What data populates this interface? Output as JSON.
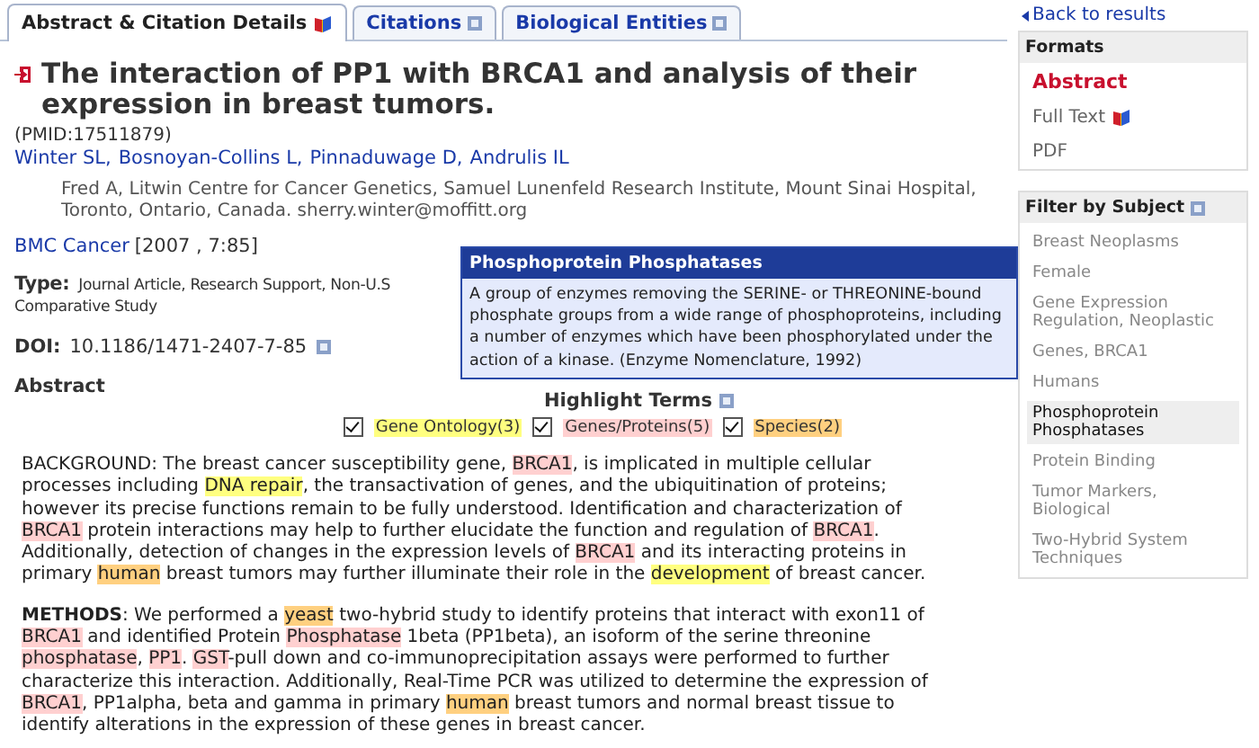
{
  "tabs": [
    {
      "label": "Abstract & Citation Details",
      "selected": true
    },
    {
      "label": "Citations",
      "selected": false
    },
    {
      "label": "Biological Entities",
      "selected": false
    }
  ],
  "article": {
    "title": "The interaction of PP1 with BRCA1 and analysis of their expression in breast tumors.",
    "pmid": "(PMID:17511879)",
    "authors": [
      "Winter SL",
      "Bosnoyan-Collins L",
      "Pinnaduwage D",
      "Andrulis IL"
    ],
    "author_separator": ",",
    "affiliation": "Fred A, Litwin Centre for Cancer Genetics, Samuel Lunenfeld Research Institute, Mount Sinai Hospital, Toronto, Ontario, Canada. sherry.winter@moffitt.org",
    "journal": "BMC Cancer",
    "journal_ref": "[2007 , 7:85]",
    "type_label": "Type:",
    "type_lines": [
      "Journal Article, Research Support, Non-U.S",
      "Comparative Study"
    ],
    "doi_label": "DOI:",
    "doi": "10.1186/1471-2407-7-85",
    "abstract_label": "Abstract"
  },
  "highlight_terms": {
    "title": "Highlight Terms",
    "terms": [
      {
        "label": "Gene Ontology(3)",
        "checked": true,
        "kind": "go"
      },
      {
        "label": "Genes/Proteins(5)",
        "checked": true,
        "kind": "gene"
      },
      {
        "label": "Species(2)",
        "checked": true,
        "kind": "species"
      }
    ]
  },
  "paragraphs": [
    {
      "segments": [
        {
          "kind": "plain",
          "text": "BACKGROUND: The breast cancer susceptibility gene, "
        },
        {
          "kind": "gene",
          "text": "BRCA1"
        },
        {
          "kind": "plain",
          "text": ", is implicated in multiple cellular processes including "
        },
        {
          "kind": "go",
          "text": "DNA repair"
        },
        {
          "kind": "plain",
          "text": ", the transactivation of genes, and the ubiquitination of proteins; however its precise functions remain to be fully understood. Identification and characterization of "
        },
        {
          "kind": "gene",
          "text": "BRCA1"
        },
        {
          "kind": "plain",
          "text": " protein interactions may help to further elucidate the function and regulation of "
        },
        {
          "kind": "gene",
          "text": "BRCA1"
        },
        {
          "kind": "plain",
          "text": ". Additionally, detection of changes in the expression levels of "
        },
        {
          "kind": "gene",
          "text": "BRCA1"
        },
        {
          "kind": "plain",
          "text": " and its interacting proteins in primary "
        },
        {
          "kind": "species",
          "text": "human"
        },
        {
          "kind": "plain",
          "text": " breast tumors may further illuminate their role in the "
        },
        {
          "kind": "go",
          "text": "development"
        },
        {
          "kind": "plain",
          "text": " of breast cancer."
        }
      ]
    },
    {
      "segments": [
        {
          "kind": "bold",
          "text": "METHODS"
        },
        {
          "kind": "plain",
          "text": ": We performed a "
        },
        {
          "kind": "species",
          "text": "yeast"
        },
        {
          "kind": "plain",
          "text": " two-hybrid study to identify proteins that interact with exon11 of "
        },
        {
          "kind": "gene",
          "text": "BRCA1"
        },
        {
          "kind": "plain",
          "text": " and identified Protein "
        },
        {
          "kind": "gene",
          "text": "Phosphatase"
        },
        {
          "kind": "plain",
          "text": " 1beta (PP1beta), an isoform of the serine threonine "
        },
        {
          "kind": "gene",
          "text": "phosphatase"
        },
        {
          "kind": "plain",
          "text": ", "
        },
        {
          "kind": "gene",
          "text": "PP1"
        },
        {
          "kind": "plain",
          "text": ". "
        },
        {
          "kind": "gene",
          "text": "GST"
        },
        {
          "kind": "plain",
          "text": "-pull down and co-immunoprecipitation assays were performed to further characterize this interaction. Additionally, Real-Time PCR was utilized to determine the expression of "
        },
        {
          "kind": "gene",
          "text": "BRCA1"
        },
        {
          "kind": "plain",
          "text": ", PP1alpha, beta and gamma in primary "
        },
        {
          "kind": "species",
          "text": "human"
        },
        {
          "kind": "plain",
          "text": " breast tumors and normal breast tissue to identify alterations in the expression of these genes in breast cancer."
        }
      ]
    }
  ],
  "tooltip": {
    "title": "Phosphoprotein Phosphatases",
    "text": "A group of enzymes removing the SERINE- or THREONINE-bound phosphate groups from a wide range of phosphoproteins, including a number of enzymes which have been phosphorylated under the action of a kinase. (Enzyme Nomenclature, 1992)"
  },
  "sidebar": {
    "back": "Back to results",
    "formats": {
      "title": "Formats",
      "items": [
        {
          "label": "Abstract",
          "selected": true
        },
        {
          "label": "Full Text",
          "selected": false
        },
        {
          "label": "PDF",
          "selected": false
        }
      ]
    },
    "filter": {
      "title": "Filter by Subject",
      "items": [
        {
          "label": "Breast Neoplasms",
          "selected": false
        },
        {
          "label": "Female",
          "selected": false
        },
        {
          "label": "Gene Expression Regulation, Neoplastic",
          "selected": false
        },
        {
          "label": "Genes, BRCA1",
          "selected": false
        },
        {
          "label": "Humans",
          "selected": false
        },
        {
          "label": "Phosphoprotein Phosphatases",
          "selected": true
        },
        {
          "label": "Protein Binding",
          "selected": false
        },
        {
          "label": "Tumor Markers, Biological",
          "selected": false
        },
        {
          "label": "Two-Hybrid System Techniques",
          "selected": false
        }
      ]
    }
  }
}
